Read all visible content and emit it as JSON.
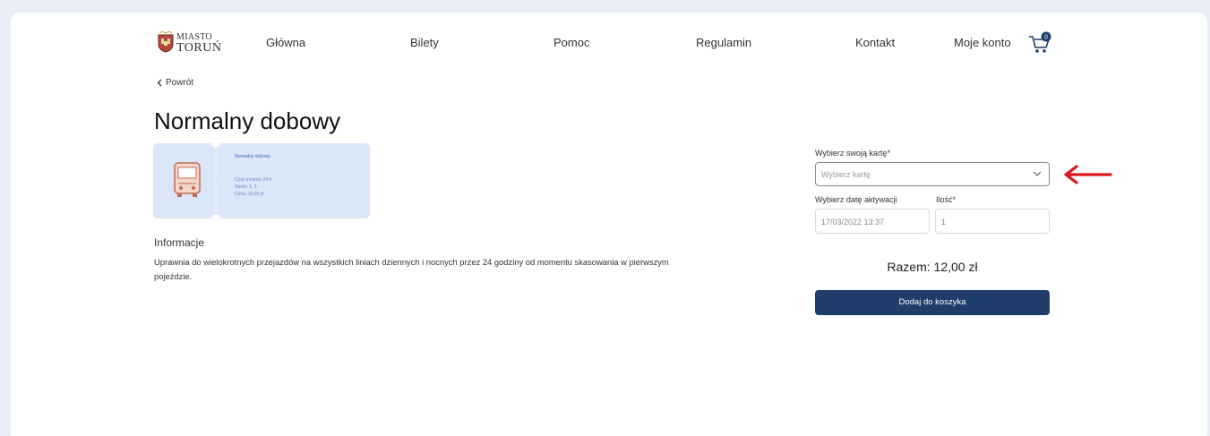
{
  "header": {
    "logo_top": "MIASTO",
    "logo_bottom": "TORUŃ",
    "nav": [
      "Główna",
      "Bilety",
      "Pomoc",
      "Regulamin",
      "Kontakt",
      "Moje konto"
    ],
    "cart_count": "0"
  },
  "back_label": "Powrót",
  "title": "Normalny dobowy",
  "ticket": {
    "name": "Normalny dobowy",
    "line1": "Czas trwania: 24 h",
    "line2": "Strefa: 1, 2",
    "line3": "Cena: 12,00 zł"
  },
  "info": {
    "heading": "Informacje",
    "text": "Uprawnia do wielokrotnych przejazdów na wszystkich liniach dziennych i nocnych przez 24 godziny od momentu skasowania w pierwszym pojeździe."
  },
  "form": {
    "card_label": "Wybierz swoją kartę*",
    "card_placeholder": "Wybierz kartę",
    "date_label": "Wybierz datę aktywacji",
    "date_value": "17/03/2022 13:37",
    "qty_label": "Ilość*",
    "qty_value": "1",
    "total": "Razem: 12,00 zł",
    "add_button": "Dodaj do koszyka"
  },
  "colors": {
    "page_bg": "#e8edf8",
    "primary": "#1e3d6b",
    "ticket_bg": "#dce6f9",
    "arrow": "#e0141e"
  }
}
